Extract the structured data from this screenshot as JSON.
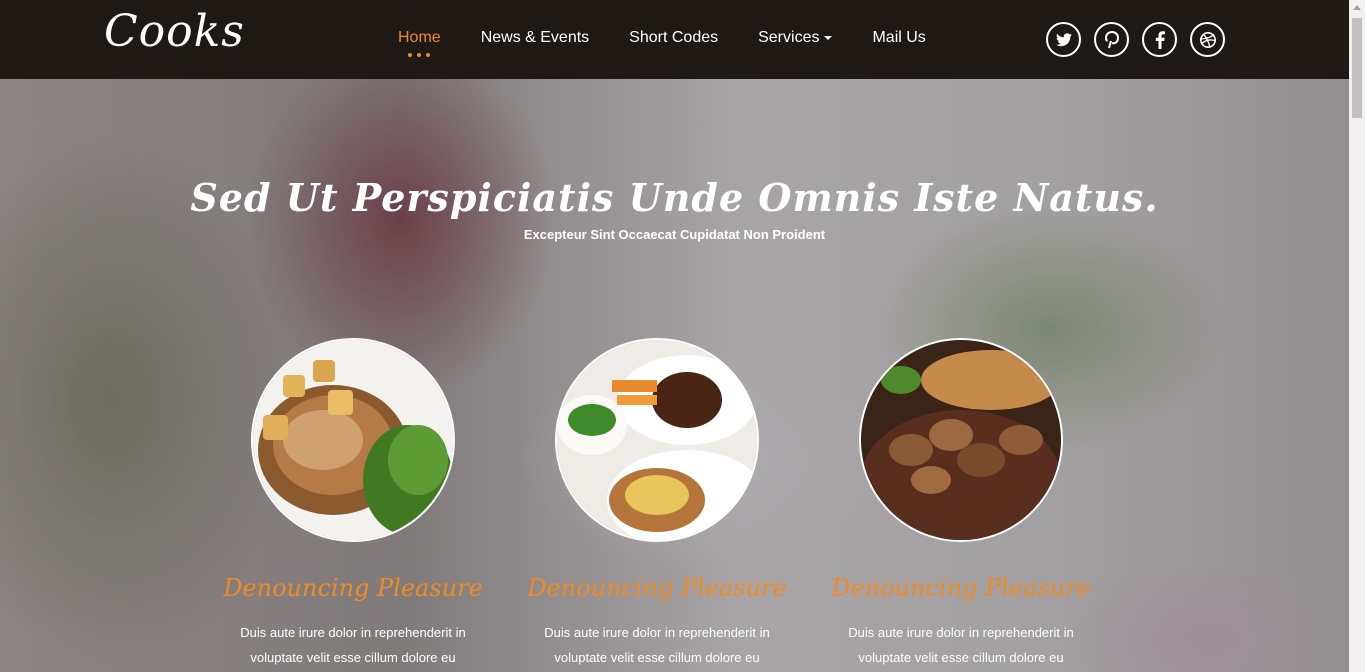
{
  "header": {
    "logo": "Cooks",
    "nav": [
      {
        "label": "Home",
        "active": true
      },
      {
        "label": "News & Events"
      },
      {
        "label": "Short Codes"
      },
      {
        "label": "Services",
        "dropdown": true
      },
      {
        "label": "Mail Us"
      }
    ],
    "social": [
      "twitter-icon",
      "pinterest-icon",
      "facebook-icon",
      "dribbble-icon"
    ]
  },
  "hero": {
    "title": "Sed Ut Perspiciatis Unde Omnis Iste Natus.",
    "subtitle": "Excepteur Sint Occaecat Cupidatat Non Proident"
  },
  "cards": [
    {
      "title": "Denouncing Pleasure",
      "text": "Duis aute irure dolor in reprehenderit in voluptate velit esse cillum dolore eu"
    },
    {
      "title": "Denouncing Pleasure",
      "text": "Duis aute irure dolor in reprehenderit in voluptate velit esse cillum dolore eu"
    },
    {
      "title": "Denouncing Pleasure",
      "text": "Duis aute irure dolor in reprehenderit in voluptate velit esse cillum dolore eu"
    }
  ],
  "colors": {
    "accent": "#f08a24",
    "header_bg": "#1e1915"
  }
}
